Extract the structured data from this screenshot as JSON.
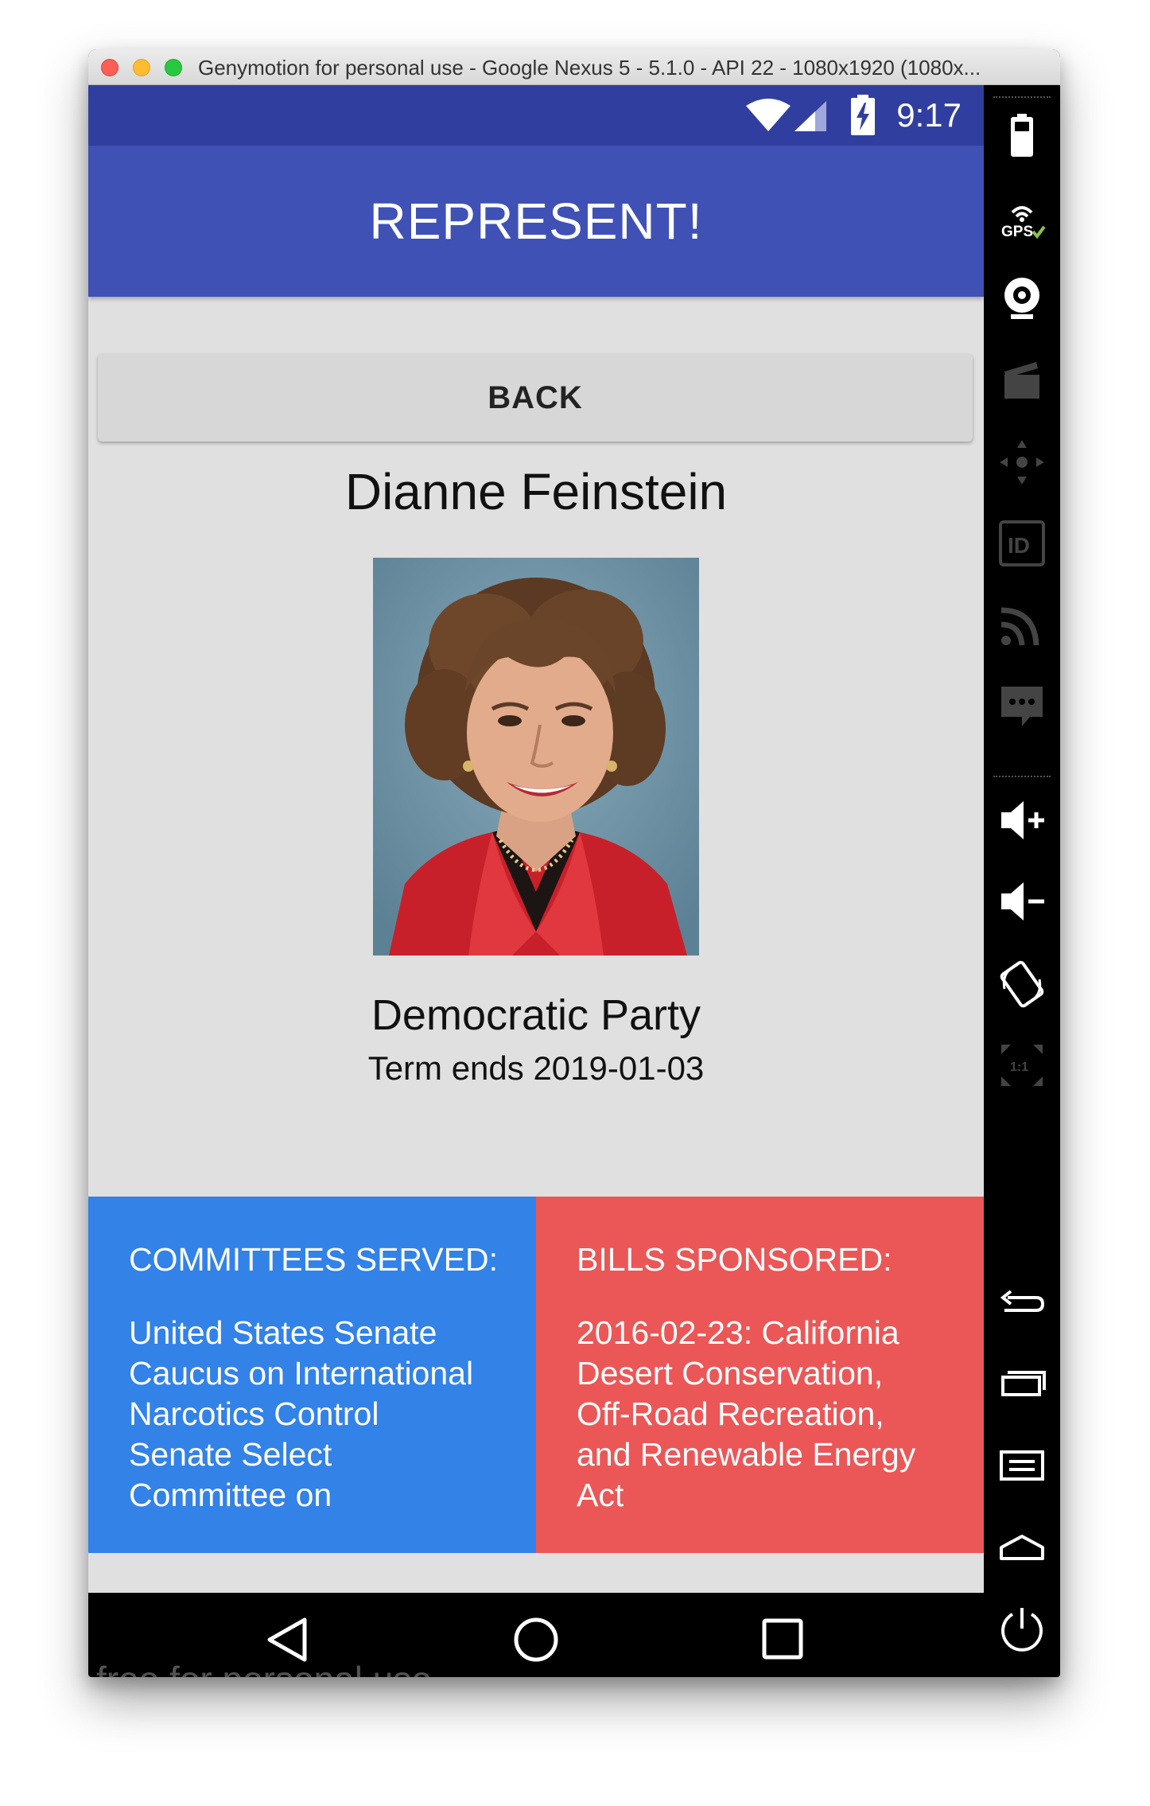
{
  "window": {
    "title": "Genymotion for personal use - Google Nexus 5 - 5.1.0 - API 22 - 1080x1920 (1080x..."
  },
  "status_bar": {
    "time": "9:17",
    "icons": [
      "wifi-icon",
      "signal-icon",
      "battery-charging-icon"
    ]
  },
  "app_bar": {
    "title": "REPRESENT!"
  },
  "back_button": {
    "label": "BACK"
  },
  "representative": {
    "name": "Dianne Feinstein",
    "party": "Democratic Party",
    "term": "Term ends 2019-01-03"
  },
  "committees": {
    "heading": "COMMITTEES SERVED:",
    "lines": [
      "United States Senate",
      "Caucus on International",
      "Narcotics Control",
      "Senate Select",
      "Committee on"
    ]
  },
  "bills": {
    "heading": "BILLS SPONSORED:",
    "lines": [
      "2016-02-23: California",
      "Desert Conservation,",
      "Off-Road Recreation,",
      "and Renewable Energy",
      "Act"
    ]
  },
  "nav_bar": {
    "buttons": [
      "back-nav-icon",
      "home-nav-icon",
      "recents-nav-icon"
    ]
  },
  "watermark": "free for personal use",
  "sidebar": {
    "tools": [
      "battery-icon",
      "gps-icon",
      "webcam-icon",
      "screencast-icon",
      "dpad-icon",
      "device-id-icon",
      "network-icon",
      "sms-icon",
      "volume-up-icon",
      "volume-down-icon",
      "rotate-icon",
      "pixel-perfect-icon",
      "back-icon",
      "recent-apps-icon",
      "menu-icon",
      "home-icon",
      "power-icon"
    ]
  },
  "colors": {
    "status_bar": "#303f9f",
    "app_bar": "#3f51b5",
    "committees_panel": "#3282e8",
    "bills_panel": "#eb5757",
    "background": "#e0e0e0"
  }
}
